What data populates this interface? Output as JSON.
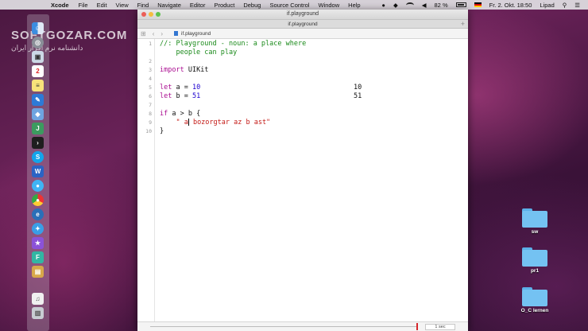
{
  "menubar": {
    "app": "Xcode",
    "items": [
      "File",
      "Edit",
      "View",
      "Find",
      "Navigate",
      "Editor",
      "Product",
      "Debug",
      "Source Control",
      "Window",
      "Help"
    ],
    "battery": "82 %",
    "datetime": "Fr. 2. Okt.  18:50",
    "user": "Lipad"
  },
  "window": {
    "title": "if.playground",
    "tab_title": "if.playground",
    "jump_file": "if.playground"
  },
  "editor": {
    "line_numbers": [
      "1",
      "2",
      "3",
      "4",
      "5",
      "6",
      "7",
      "8",
      "9",
      "10"
    ],
    "code": {
      "l1a": "//: Playground - noun: a place where",
      "l1b": "    people can play",
      "import_kw": "import",
      "import_mod": " UIKit",
      "let_kw": "let",
      "a_decl": " a = ",
      "a_val": "10",
      "b_decl": " b = ",
      "b_val": "51",
      "if_kw": "if",
      "cond": " a > b {",
      "print_pre": "    \" a",
      "print_post": " bozorgtar az b ast\"",
      "close": "}"
    },
    "results": [
      "10",
      "51"
    ]
  },
  "bottombar": {
    "stepper": "1 sec"
  },
  "desktop": {
    "folders": [
      "sw",
      "pr1",
      "O_C lernen"
    ]
  },
  "watermark": {
    "line1": "SOFTGOZAR.COM",
    "line2": "دانشنامه نرم افزار ایران"
  },
  "colors": {
    "comment": "#1a8a1a",
    "keyword": "#aa0d91",
    "number": "#1c00cf",
    "string": "#c41a16"
  }
}
